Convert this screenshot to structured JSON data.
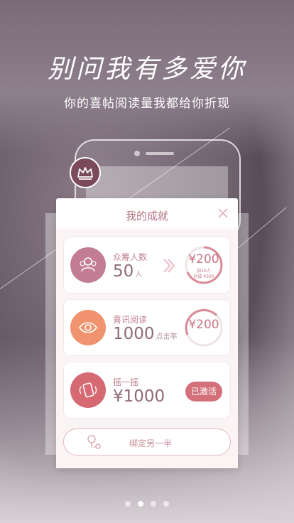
{
  "headline": "别问我有多爱你",
  "subtitle": "你的喜帖阅读量我都给你折现",
  "modal": {
    "title": "我的成就",
    "cards": [
      {
        "label": "众筹人数",
        "value": "50",
        "unit": "人",
        "reward": "¥200",
        "reward_sub1": "加10人",
        "reward_sub2": "达成 ¥300"
      },
      {
        "label": "喜讯阅读",
        "value": "1000",
        "unit": "点击率",
        "reward": "¥200"
      },
      {
        "label": "摇一摇",
        "value": "¥1000",
        "status": "已激活"
      }
    ],
    "bind_button": "绑定另一半"
  },
  "pager": {
    "count": 4,
    "active": 1
  },
  "colors": {
    "accent": "#d4707a",
    "card1_icon": "#c27d94",
    "card2_icon": "#f0936e",
    "card3_icon": "#d66a73"
  }
}
